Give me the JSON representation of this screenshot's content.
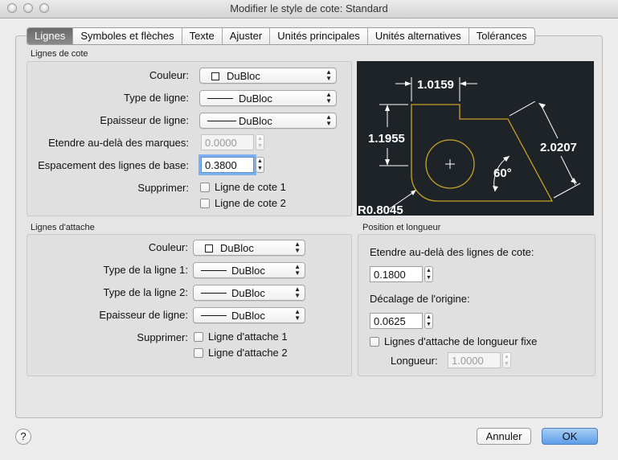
{
  "window": {
    "title": "Modifier le style de cote: Standard"
  },
  "tabs": [
    "Lignes",
    "Symboles et flèches",
    "Texte",
    "Ajuster",
    "Unités principales",
    "Unités alternatives",
    "Tolérances"
  ],
  "dim_lines": {
    "group_label": "Lignes de cote",
    "color_label": "Couleur:",
    "color_value": "DuBloc",
    "linetype_label": "Type de ligne:",
    "linetype_value": "DuBloc",
    "lineweight_label": "Epaisseur de ligne:",
    "lineweight_value": "DuBloc",
    "extend_label": "Etendre au-delà des marques:",
    "extend_value": "0.0000",
    "baseline_label": "Espacement des lignes de base:",
    "baseline_value": "0.3800",
    "suppress_label": "Supprimer:",
    "suppress_1": "Ligne de cote 1",
    "suppress_2": "Ligne de cote 2"
  },
  "preview": {
    "dim_top": "1.0159",
    "dim_left": "1.1955",
    "dim_right": "2.0207",
    "angle": "60°",
    "radius": "R0.8045",
    "colors": {
      "background": "#1e2328",
      "geometry": "#c9a227",
      "dimension": "#ffffff"
    }
  },
  "ext_lines": {
    "group_label": "Lignes d'attache",
    "color_label": "Couleur:",
    "color_value": "DuBloc",
    "linetype1_label": "Type de la ligne 1:",
    "linetype1_value": "DuBloc",
    "linetype2_label": "Type de la ligne 2:",
    "linetype2_value": "DuBloc",
    "lineweight_label": "Epaisseur de ligne:",
    "lineweight_value": "DuBloc",
    "suppress_label": "Supprimer:",
    "suppress_1": "Ligne d'attache 1",
    "suppress_2": "Ligne d'attache 2"
  },
  "position": {
    "group_label": "Position et longueur",
    "extend_label": "Etendre au-delà des lignes de cote:",
    "extend_value": "0.1800",
    "offset_label": "Décalage de l'origine:",
    "offset_value": "0.0625",
    "fixed_label": "Lignes d'attache de longueur fixe",
    "length_label": "Longueur:",
    "length_value": "1.0000"
  },
  "buttons": {
    "help": "?",
    "cancel": "Annuler",
    "ok": "OK"
  },
  "accent": "#5d9ee9"
}
